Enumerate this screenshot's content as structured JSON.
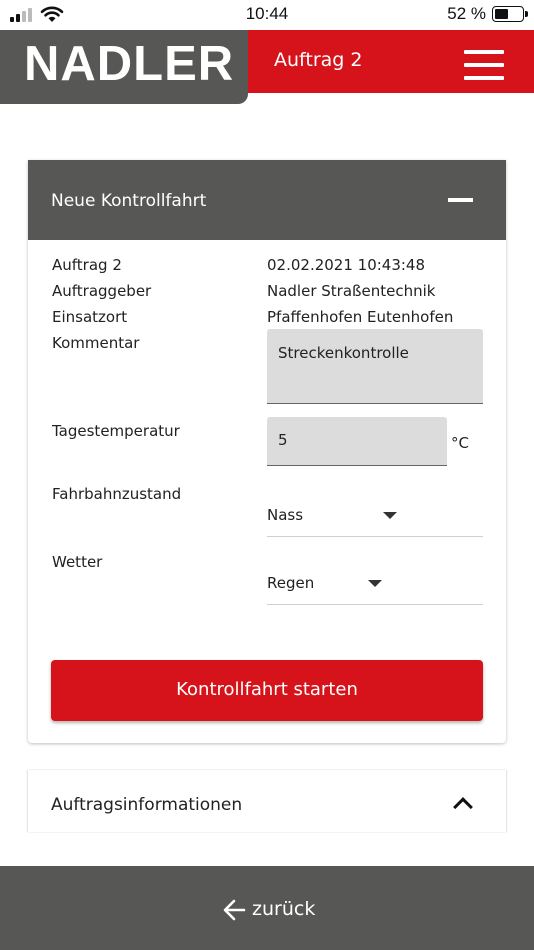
{
  "status_bar": {
    "time": "10:44",
    "battery_percent": "52 %",
    "battery_level": 0.52,
    "signal_icon": "signal-bars-icon",
    "wifi_icon": "wifi-icon"
  },
  "header": {
    "logo_text": "NADLER",
    "title": "Auftrag 2",
    "menu_icon": "hamburger-menu-icon",
    "colors": {
      "brand_red": "#d6131b",
      "brand_gray": "#575756"
    }
  },
  "card": {
    "title": "Neue Kontrollfahrt",
    "collapse_icon": "minus-icon",
    "info_rows": [
      {
        "label": "Auftrag 2",
        "value": "02.02.2021 10:43:48"
      },
      {
        "label": "Auftraggeber",
        "value": "Nadler Straßentechnik"
      },
      {
        "label": "Einsatzort",
        "value": "Pfaffenhofen Eutenhofen"
      }
    ],
    "comment": {
      "label": "Kommentar",
      "value": "Streckenkontrolle"
    },
    "temperature": {
      "label": "Tagestemperatur",
      "value": "5",
      "unit": "°C"
    },
    "road_condition": {
      "label": "Fahrbahnzustand",
      "selected": "Nass"
    },
    "weather": {
      "label": "Wetter",
      "selected": "Regen"
    },
    "start_button": "Kontrollfahrt starten"
  },
  "card2": {
    "title": "Auftragsinformationen",
    "expand_icon": "chevron-up-icon"
  },
  "footer": {
    "back_label": "zurück",
    "back_icon": "arrow-left-icon"
  }
}
